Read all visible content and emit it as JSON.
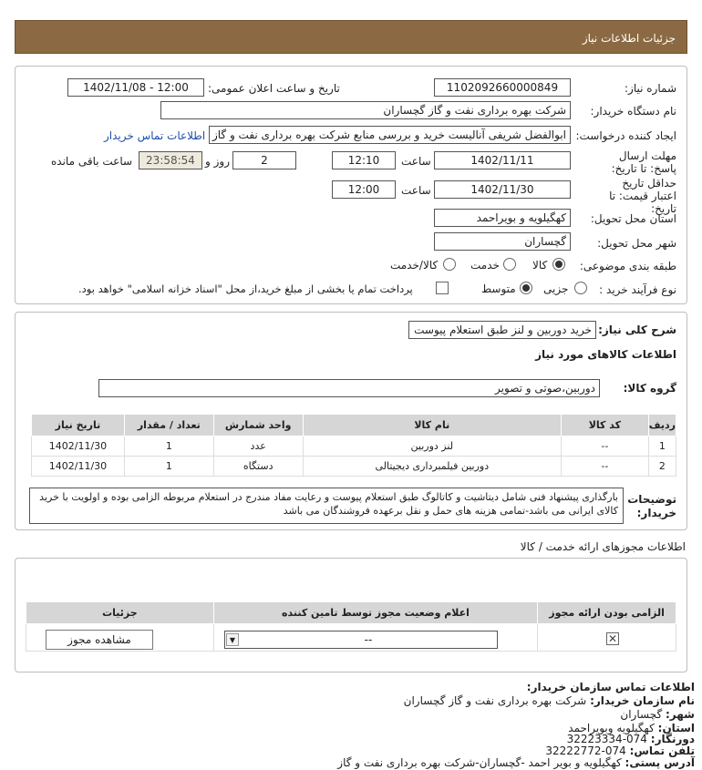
{
  "header": {
    "title": "جزئیات اطلاعات نیاز"
  },
  "form": {
    "need_number_label": "شماره نیاز:",
    "need_number": "1102092660000849",
    "announce_label": "تاریخ و ساعت اعلان عمومی:",
    "announce_value": "1402/11/08 - 12:00",
    "buyer_label": "نام دستگاه خریدار:",
    "buyer_value": "شرکت بهره برداری نفت و گاز گچساران",
    "creator_label": "ایجاد کننده درخواست:",
    "creator_value": "ابوالفضل شریفی آنالیست خرید و بررسی منابع شرکت بهره برداری نفت و گاز گچ",
    "contact_link": "اطلاعات تماس خریدار",
    "deadline_label": "مهلت ارسال پاسخ: تا تاریخ:",
    "deadline_date": "1402/11/11",
    "time_label": "ساعت",
    "deadline_time": "12:10",
    "days_value": "2",
    "days_label": "روز و",
    "remaining_value": "23:58:54",
    "remaining_label": "ساعت باقی مانده",
    "validity_label": "حداقل تاریخ اعتبار قیمت: تا تاریخ:",
    "validity_date": "1402/11/30",
    "validity_time": "12:00",
    "province_label": "استان محل تحویل:",
    "province_value": "کهگیلویه و بویراحمد",
    "city_label": "شهر محل تحویل:",
    "city_value": "گچساران",
    "category_label": "طبقه بندی موضوعی:",
    "category_options": [
      "کالا",
      "خدمت",
      "کالا/خدمت"
    ],
    "process_label": "نوع فرآیند خرید :",
    "process_options": [
      "جزیی",
      "متوسط"
    ],
    "payment_note": "پرداخت تمام یا بخشی از مبلغ خرید،از محل \"اسناد خزانه اسلامی\" خواهد بود."
  },
  "needs": {
    "summary_label": "شرح کلی نیاز:",
    "summary_value": "خرید دوربین و لنز طبق استعلام پیوست",
    "goods_info_title": "اطلاعات کالاهای مورد نیاز",
    "group_label": "گروه کالا:",
    "group_value": "دوربین،صوتی و تصویر",
    "table_headers": [
      "ردیف",
      "کد کالا",
      "نام کالا",
      "واحد شمارش",
      "تعداد / مقدار",
      "تاریخ نیاز"
    ],
    "rows": [
      [
        "1",
        "--",
        "لنز دوربین",
        "عدد",
        "1",
        "1402/11/30"
      ],
      [
        "2",
        "--",
        "دوربین فیلمبرداری دیجیتالی",
        "دستگاه",
        "1",
        "1402/11/30"
      ]
    ],
    "desc_label": "توضیحات خریدار:",
    "desc_value": "بارگذاری پیشنهاد فنی شامل دیتاشیت و کاتالوگ طبق استعلام پیوست و رعایت مفاد مندرج در استعلام مربوطه الزامی بوده و اولویت با خرید کالای ایرانی می باشد-تمامی هزینه های حمل و نقل برعهده فروشندگان می باشد"
  },
  "permits": {
    "title": "اطلاعات مجوزهای ارائه خدمت / کالا",
    "headers": [
      "الزامی بودن ارائه مجوز",
      "اعلام وضعیت مجوز توسط تامین کننده",
      "جزئیات"
    ],
    "select_value": "--",
    "view_button": "مشاهده مجوز"
  },
  "contact": {
    "title": "اطلاعات تماس سازمان خریدار:",
    "org_label": "نام سازمان خریدار:",
    "org_value": "شرکت بهره برداری نفت و گاز گچساران",
    "city_label": "شهر:",
    "city_value": "گچساران",
    "province_label": "استان:",
    "province_value": "کهگیلویه وبویراحمد",
    "fax_label": "دورنگار:",
    "fax_value": "074-32223334",
    "phone_label": "تلفن تماس:",
    "phone_value": "074-32222772",
    "address_label": "آدرس پستی:",
    "address_value": "کهگیلویه و بویر احمد -گچساران-شرکت بهره برداری نفت و گاز"
  },
  "colors": {
    "header_bg": "#8b6a43",
    "table_header_bg": "#d6d6d6",
    "link": "#1f4ea8"
  }
}
